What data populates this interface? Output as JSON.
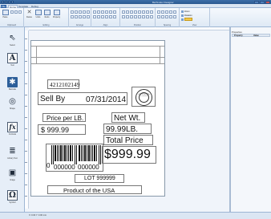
{
  "window": {
    "title": "BarTender Designer"
  },
  "ribbon": {
    "tabs": [
      "File",
      "Home",
      "Template",
      "Debug"
    ],
    "groups": {
      "clipboard": "Clipboard",
      "editing": "Editing",
      "arrange": "Arrange",
      "align": "Align",
      "position": "Position",
      "spacing": "Spacing",
      "view": "View"
    },
    "buttons": {
      "paste": "Paste",
      "cut": "Delete",
      "undo": "Undo",
      "redo": "Redo",
      "properties": "Property"
    },
    "view": {
      "zoom_label": "Zoom",
      "rotation_label": "Rotation"
    }
  },
  "toolbox": {
    "items": [
      {
        "label": "Select",
        "icon": "pointer-icon",
        "glyph": "⇖"
      },
      {
        "label": "Text",
        "icon": "text-icon",
        "glyph": "A"
      },
      {
        "label": "Barcode",
        "icon": "barcode-icon",
        "glyph": "✱"
      },
      {
        "label": "Shape",
        "icon": "shape-icon",
        "glyph": "◎"
      },
      {
        "label": "Formula",
        "icon": "formula-icon",
        "glyph": "fx"
      },
      {
        "label": "Library Text",
        "icon": "library-icon",
        "glyph": "≣"
      },
      {
        "label": "Image",
        "icon": "image-icon",
        "glyph": "▣"
      },
      {
        "label": "Symbol",
        "icon": "symbol-icon",
        "glyph": "Ω"
      }
    ]
  },
  "label": {
    "serial": "4212102149",
    "sell_by_label": "Sell By",
    "sell_by_date": "07/31/2014",
    "price_per_label": "Price per LB.",
    "price_value": "$ 999.99",
    "net_wt_label": "Net Wt.",
    "net_wt_value": "99.99LB.",
    "total_price_label": "Total Price",
    "total_price_value": "$999.99",
    "barcode_lead": "0",
    "barcode_left": "000000",
    "barcode_right": "000000",
    "lot": "LOT 999999",
    "origin": "Product of the USA",
    "seal_text": "U.S. INSPECTED AND PASSED BY DEPARTMENT OF AGRICULTURE"
  },
  "properties": {
    "title": "Properties",
    "columns": [
      "Property",
      "Value"
    ]
  },
  "status": {
    "text": "X: 0.00 Y: 0.00 mm"
  },
  "colors": {
    "titlebar": "#2a5990",
    "ribbon": "#dfe9f5",
    "workspace": "#f0f4fa",
    "label": "#ffffff"
  }
}
